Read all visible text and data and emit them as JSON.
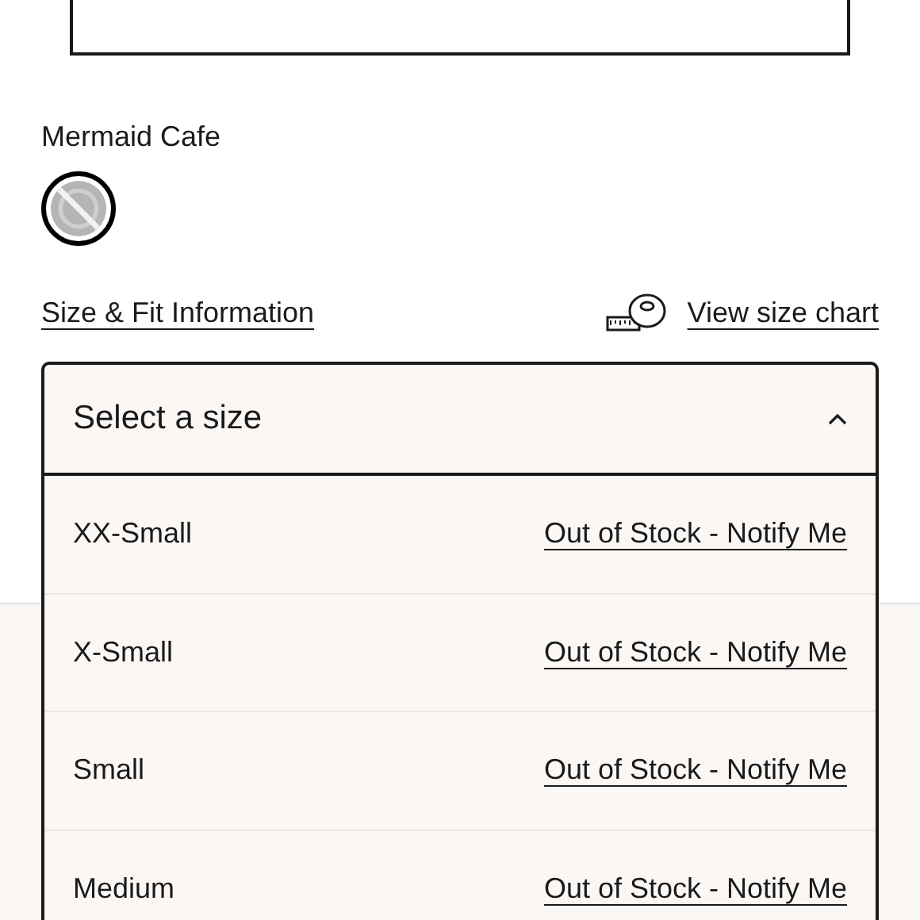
{
  "color": {
    "name": "Mermaid Cafe"
  },
  "swatches": [
    {
      "selected": true,
      "unavailable": true
    }
  ],
  "links": {
    "size_fit": "Size & Fit Information",
    "size_chart": "View size chart"
  },
  "size_select": {
    "label": "Select a size",
    "expanded": true,
    "options": [
      {
        "size": "XX-Small",
        "status": "Out of Stock - Notify Me"
      },
      {
        "size": "X-Small",
        "status": "Out of Stock - Notify Me"
      },
      {
        "size": "Small",
        "status": "Out of Stock - Notify Me"
      },
      {
        "size": "Medium",
        "status": "Out of Stock - Notify Me"
      }
    ]
  }
}
